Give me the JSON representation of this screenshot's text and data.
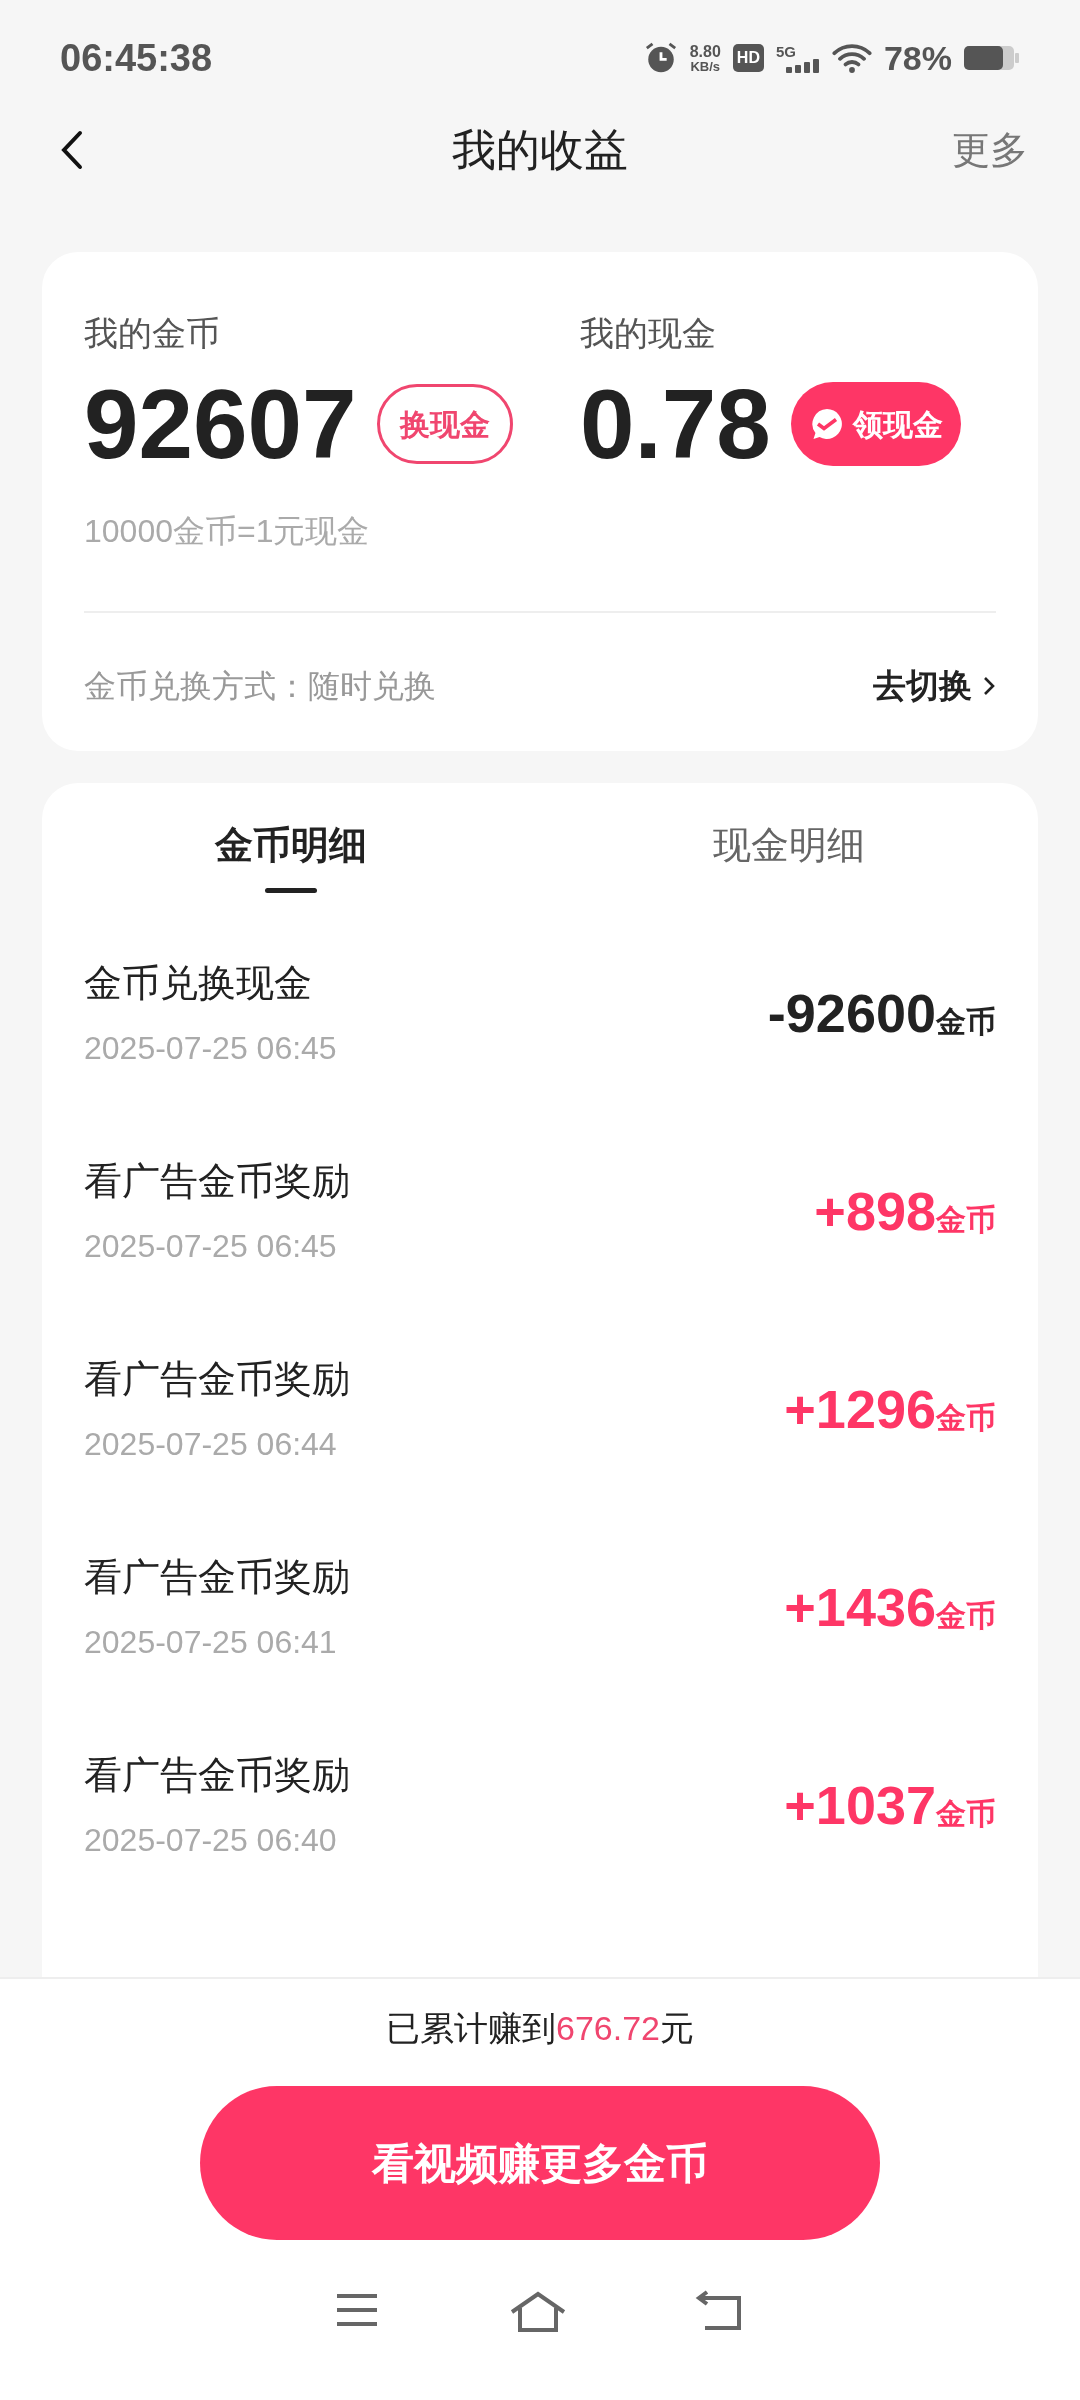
{
  "status_bar": {
    "time": "06:45:38",
    "net_speed": "8.80",
    "net_unit": "KB/s",
    "hd": "HD",
    "network": "5G",
    "battery": "78%"
  },
  "header": {
    "title": "我的收益",
    "more": "更多"
  },
  "summary": {
    "coins_label": "我的金币",
    "coins": "92607",
    "exchange_button": "换现金",
    "cash_label": "我的现金",
    "cash": "0.78",
    "withdraw_button": "领现金",
    "rate": "10000金币=1元现金",
    "method": "金币兑换方式：随时兑换",
    "switch_link": "去切换"
  },
  "tabs": [
    {
      "label": "金币明细",
      "selected": true
    },
    {
      "label": "现金明细",
      "selected": false
    }
  ],
  "records": [
    {
      "title": "金币兑换现金",
      "time": "2025-07-25 06:45",
      "amount": "-92600",
      "unit": "金币",
      "kind": "expense"
    },
    {
      "title": "看广告金币奖励",
      "time": "2025-07-25 06:45",
      "amount": "+898",
      "unit": "金币",
      "kind": "income"
    },
    {
      "title": "看广告金币奖励",
      "time": "2025-07-25 06:44",
      "amount": "+1296",
      "unit": "金币",
      "kind": "income"
    },
    {
      "title": "看广告金币奖励",
      "time": "2025-07-25 06:41",
      "amount": "+1436",
      "unit": "金币",
      "kind": "income"
    },
    {
      "title": "看广告金币奖励",
      "time": "2025-07-25 06:40",
      "amount": "+1037",
      "unit": "金币",
      "kind": "income"
    }
  ],
  "footer": {
    "total": "已累计赚到**676.72**元",
    "button": "看视频赚更多金币"
  }
}
